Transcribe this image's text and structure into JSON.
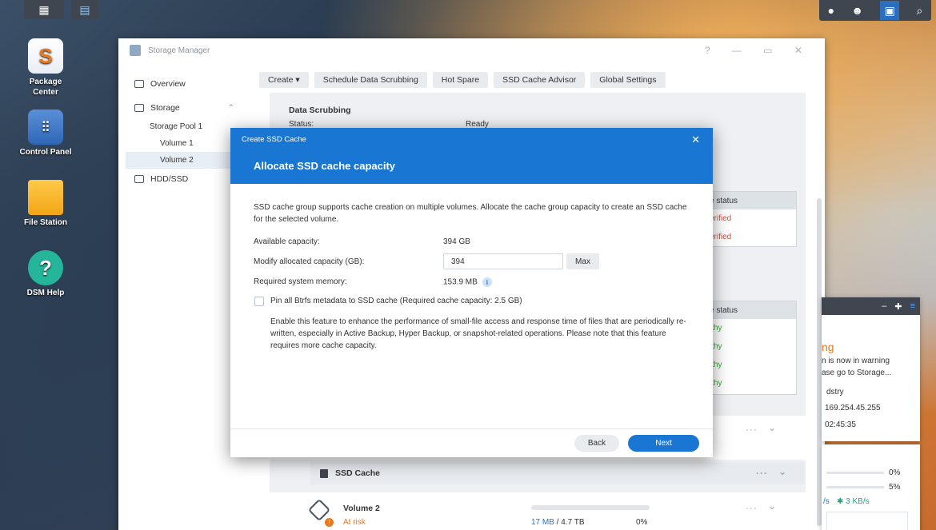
{
  "desktop": {
    "icons": [
      {
        "label": "Package Center",
        "icon": "package-center-icon"
      },
      {
        "label": "Control Panel",
        "icon": "control-panel-icon"
      },
      {
        "label": "File Station",
        "icon": "file-station-icon"
      },
      {
        "label": "DSM Help",
        "icon": "dsm-help-icon"
      }
    ]
  },
  "window": {
    "title": "Storage Manager",
    "controls": "? — ▭ ✕"
  },
  "sidebar": {
    "overview": "Overview",
    "storage": "Storage",
    "storage_pool": "Storage Pool 1",
    "volume1": "Volume 1",
    "volume2": "Volume 2",
    "hdd": "HDD/SSD"
  },
  "toolbar": {
    "create": "Create ▾",
    "scrub": "Schedule Data Scrubbing",
    "hot_spare": "Hot Spare",
    "advisor": "SSD Cache Advisor",
    "global": "Global Settings"
  },
  "background_panel": {
    "scrub_title": "Data Scrubbing",
    "status_label": "Status:",
    "status_value": "Ready",
    "box1_header": "e status",
    "box1_rows": [
      "erified",
      "erified"
    ],
    "box2_header": "e status",
    "box2_rows": [
      "lthy",
      "lthy",
      "lthy",
      "lthy"
    ],
    "ssd_cache": "SSD Cache",
    "volume2_name": "Volume 2",
    "volume2_status": "At risk",
    "volume2_used": "17 MB",
    "volume2_sep": " / ",
    "volume2_total": "4.7 TB",
    "volume2_pct": "0%",
    "volume2_fill": 0.0
  },
  "widget": {
    "warn_title": "ng",
    "warn_line1": "n is now in warning",
    "warn_line2": "ase go to Storage...",
    "server": "dstry",
    "ip": "169.254.45.255",
    "time": "02:45:35",
    "pct1": "0%",
    "pct2": "5%",
    "speed_left": "/s",
    "speed_right": "✱ 3 KB/s"
  },
  "modal": {
    "small_title": "Create SSD Cache",
    "title": "Allocate SSD cache capacity",
    "description": "SSD cache group supports cache creation on multiple volumes. Allocate the cache group capacity to create an SSD cache for the selected volume.",
    "available_label": "Available capacity:",
    "available_value": "394 GB",
    "modify_label": "Modify allocated capacity (GB):",
    "modify_value": "394",
    "max_label": "Max",
    "memory_label": "Required system memory:",
    "memory_value": "153.9 MB",
    "pin_label": "Pin all Btrfs metadata to SSD cache (Required cache capacity: 2.5 GB)",
    "pin_desc": "Enable this feature to enhance the performance of small-file access and response time of files that are periodically re-written, especially in Active Backup, Hyper Backup, or snapshot-related operations. Please note that this feature requires more cache capacity.",
    "back": "Back",
    "next": "Next"
  },
  "colors": {
    "accent": "#1976d2",
    "warning": "#e8791f",
    "ok": "#3aa43a",
    "error": "#e04a3a"
  }
}
